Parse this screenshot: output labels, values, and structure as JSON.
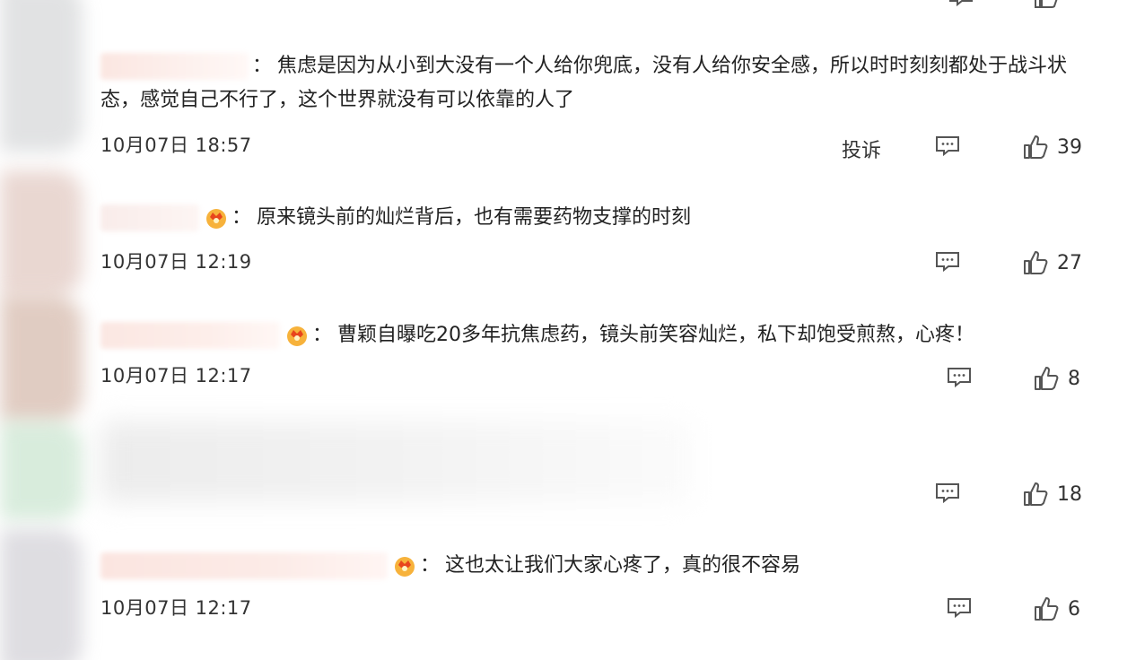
{
  "comments": [
    {
      "text": "焦虑是因为从小到大没有一个人给你兜底，没有人给你安全感，所以时时刻刻都处于战斗状态，感觉自己不行了，这个世界就没有可以依靠的人了",
      "time": "10月07日 18:57",
      "report_label": "投诉",
      "likes": "39",
      "has_badge": false
    },
    {
      "text": "原来镜头前的灿烂背后，也有需要药物支撑的时刻",
      "time": "10月07日 12:19",
      "likes": "27",
      "has_badge": true
    },
    {
      "text": "曹颖自曝吃20多年抗焦虑药，镜头前笑容灿烂，私下却饱受煎熬，心疼！",
      "time": "10月07日 12:17",
      "likes": "8",
      "has_badge": true
    },
    {
      "text": "",
      "time": "",
      "likes": "18",
      "blurred": true
    },
    {
      "text": "这也太让我们大家心疼了，真的很不容易",
      "time": "10月07日 12:17",
      "likes": "6",
      "has_badge": true
    }
  ],
  "icons": {
    "comment": "comment-icon",
    "like": "thumbs-up-icon",
    "badge": "member-badge-icon"
  },
  "colors": {
    "text": "#222222",
    "icon": "#555555",
    "badge": "#f5a623"
  }
}
